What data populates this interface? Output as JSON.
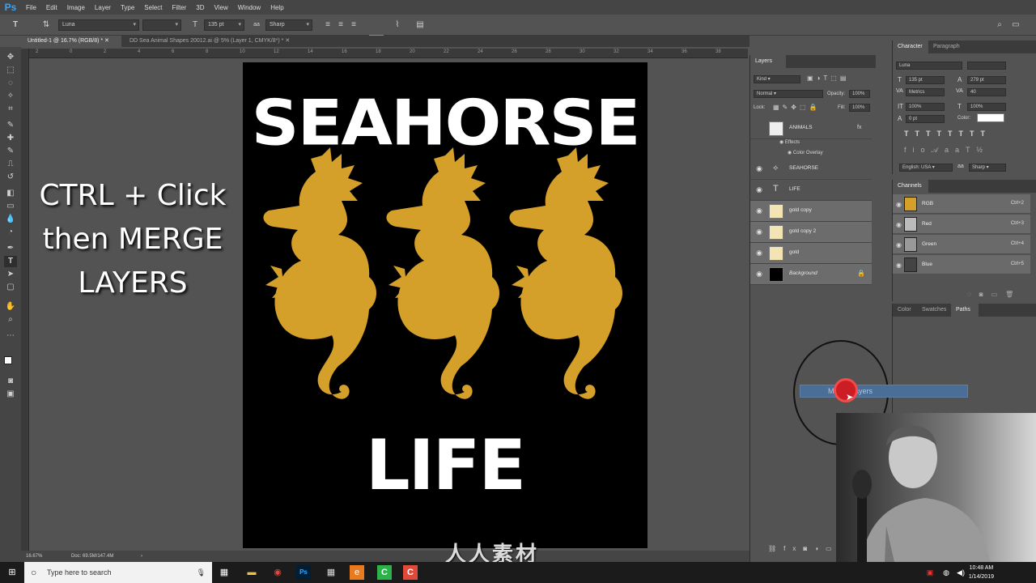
{
  "app": {
    "logo": "Ps",
    "menus": [
      "File",
      "Edit",
      "Image",
      "Layer",
      "Type",
      "Select",
      "Filter",
      "3D",
      "View",
      "Window",
      "Help"
    ]
  },
  "options": {
    "font_family": "Luna",
    "font_size": "135 pt",
    "antialias": "Sharp"
  },
  "tabs": [
    {
      "label": "Untitled-1 @ 16.7% (RGB/8) *",
      "active": true
    },
    {
      "label": "DD Sea Animal Shapes 20012.ai @ 5% (Layer 1, CMYK/8*) *",
      "active": false
    }
  ],
  "ruler_ticks": [
    "2",
    "0",
    "2",
    "4",
    "6",
    "8",
    "10",
    "12",
    "14",
    "16",
    "18",
    "20",
    "22",
    "24",
    "26",
    "28",
    "30",
    "32",
    "34",
    "36",
    "38"
  ],
  "document": {
    "title": "SEAHORSE",
    "subtitle": "LIFE",
    "bg": "#000000",
    "gold": "#d4a02a"
  },
  "caption": {
    "line1": "CTRL + Click",
    "line2": "then MERGE",
    "line3": "LAYERS"
  },
  "status": {
    "zoom": "16.67%",
    "doc": "Doc: 69.5M/147.4M"
  },
  "layers_panel": {
    "tab": "Layers",
    "kind": "Kind",
    "blend_mode": "Normal",
    "opacity_label": "Opacity:",
    "opacity": "100%",
    "lock_label": "Lock:",
    "fill_label": "Fill:",
    "fill": "100%",
    "layers": [
      {
        "name": "ANIMALS",
        "type": "group",
        "fx": true
      },
      {
        "name": "Effects",
        "type": "effects"
      },
      {
        "name": "Color Overlay",
        "type": "effect"
      },
      {
        "name": "SEAHORSE",
        "type": "text"
      },
      {
        "name": "LIFE",
        "type": "text"
      },
      {
        "name": "gold copy",
        "type": "image",
        "selected": true
      },
      {
        "name": "gold copy 2",
        "type": "image",
        "selected": true
      },
      {
        "name": "gold",
        "type": "image",
        "selected": true
      },
      {
        "name": "Background",
        "type": "background",
        "selected": true
      }
    ]
  },
  "character_panel": {
    "tabs": [
      "Character",
      "Paragraph"
    ],
    "font": "Luna",
    "size": "135 pt",
    "leading": "279 pt",
    "kerning": "Metrics",
    "tracking": "40",
    "vscale": "100%",
    "hscale": "100%",
    "baseline": "0 pt",
    "color_label": "Color:",
    "language": "English: USA",
    "antialias": "Sharp"
  },
  "channels_panel": {
    "tab": "Channels",
    "channels": [
      {
        "name": "RGB",
        "key": "Ctrl+2"
      },
      {
        "name": "Red",
        "key": "Ctrl+3"
      },
      {
        "name": "Green",
        "key": "Ctrl+4"
      },
      {
        "name": "Blue",
        "key": "Ctrl+5"
      }
    ]
  },
  "paths_panel": {
    "tabs": [
      "Color",
      "Swatches",
      "Paths"
    ]
  },
  "context_menu": {
    "item": "Merge Layers"
  },
  "taskbar": {
    "search_placeholder": "Type here to search",
    "time": "10:48 AM",
    "date": "1/14/2019"
  },
  "watermark": "人人素材"
}
